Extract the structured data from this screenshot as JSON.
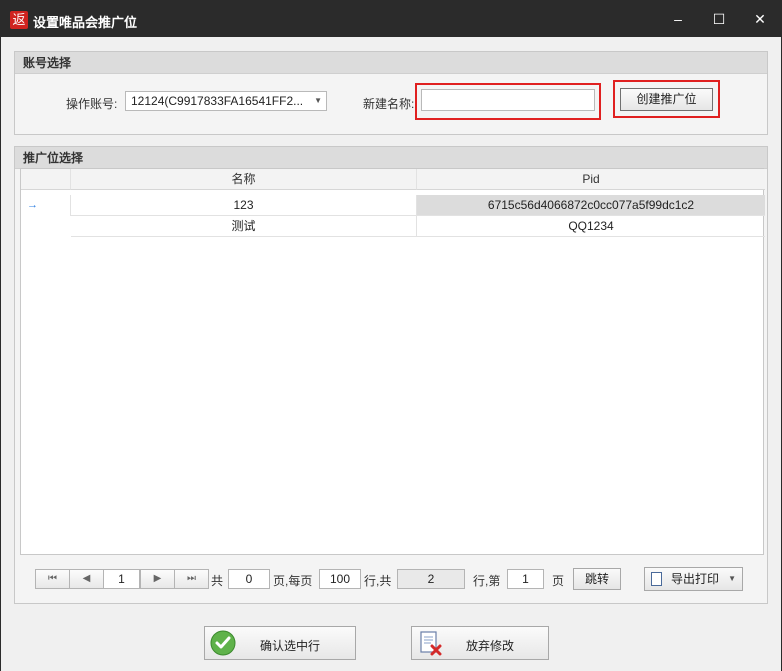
{
  "window": {
    "app_icon_glyph": "返",
    "title": "设置唯品会推广位",
    "controls": {
      "minimize": "–",
      "maximize": "☐",
      "close": "✕"
    }
  },
  "account_group": {
    "header": "账号选择",
    "account_label": "操作账号:",
    "account_value": "12124(C9917833FA16541FF2...",
    "new_name_label": "新建名称:",
    "new_name_value": "",
    "create_button": "创建推广位"
  },
  "position_group": {
    "header": "推广位选择",
    "columns": [
      "名称",
      "Pid"
    ],
    "rows": [
      {
        "indicator": "→",
        "name": "123",
        "pid": "6715c56d4066872c0cc077a5f99dc1c2"
      },
      {
        "indicator": "",
        "name": "测试",
        "pid": "QQ1234"
      }
    ]
  },
  "pager": {
    "first": "⏮",
    "prev": "◀",
    "next": "▶",
    "last": "⏭",
    "current_page": "1",
    "total_label": "共",
    "total_pages": "0",
    "per_page_label": "页,每页",
    "per_page": "100",
    "rows_label": "行,共",
    "total_rows": "2",
    "goto_label": "行,第",
    "goto_page": "1",
    "page_suffix": "页",
    "jump_button": "跳转",
    "export_button": "导出打印"
  },
  "footer": {
    "confirm_button": "确认选中行",
    "discard_button": "放弃修改"
  }
}
